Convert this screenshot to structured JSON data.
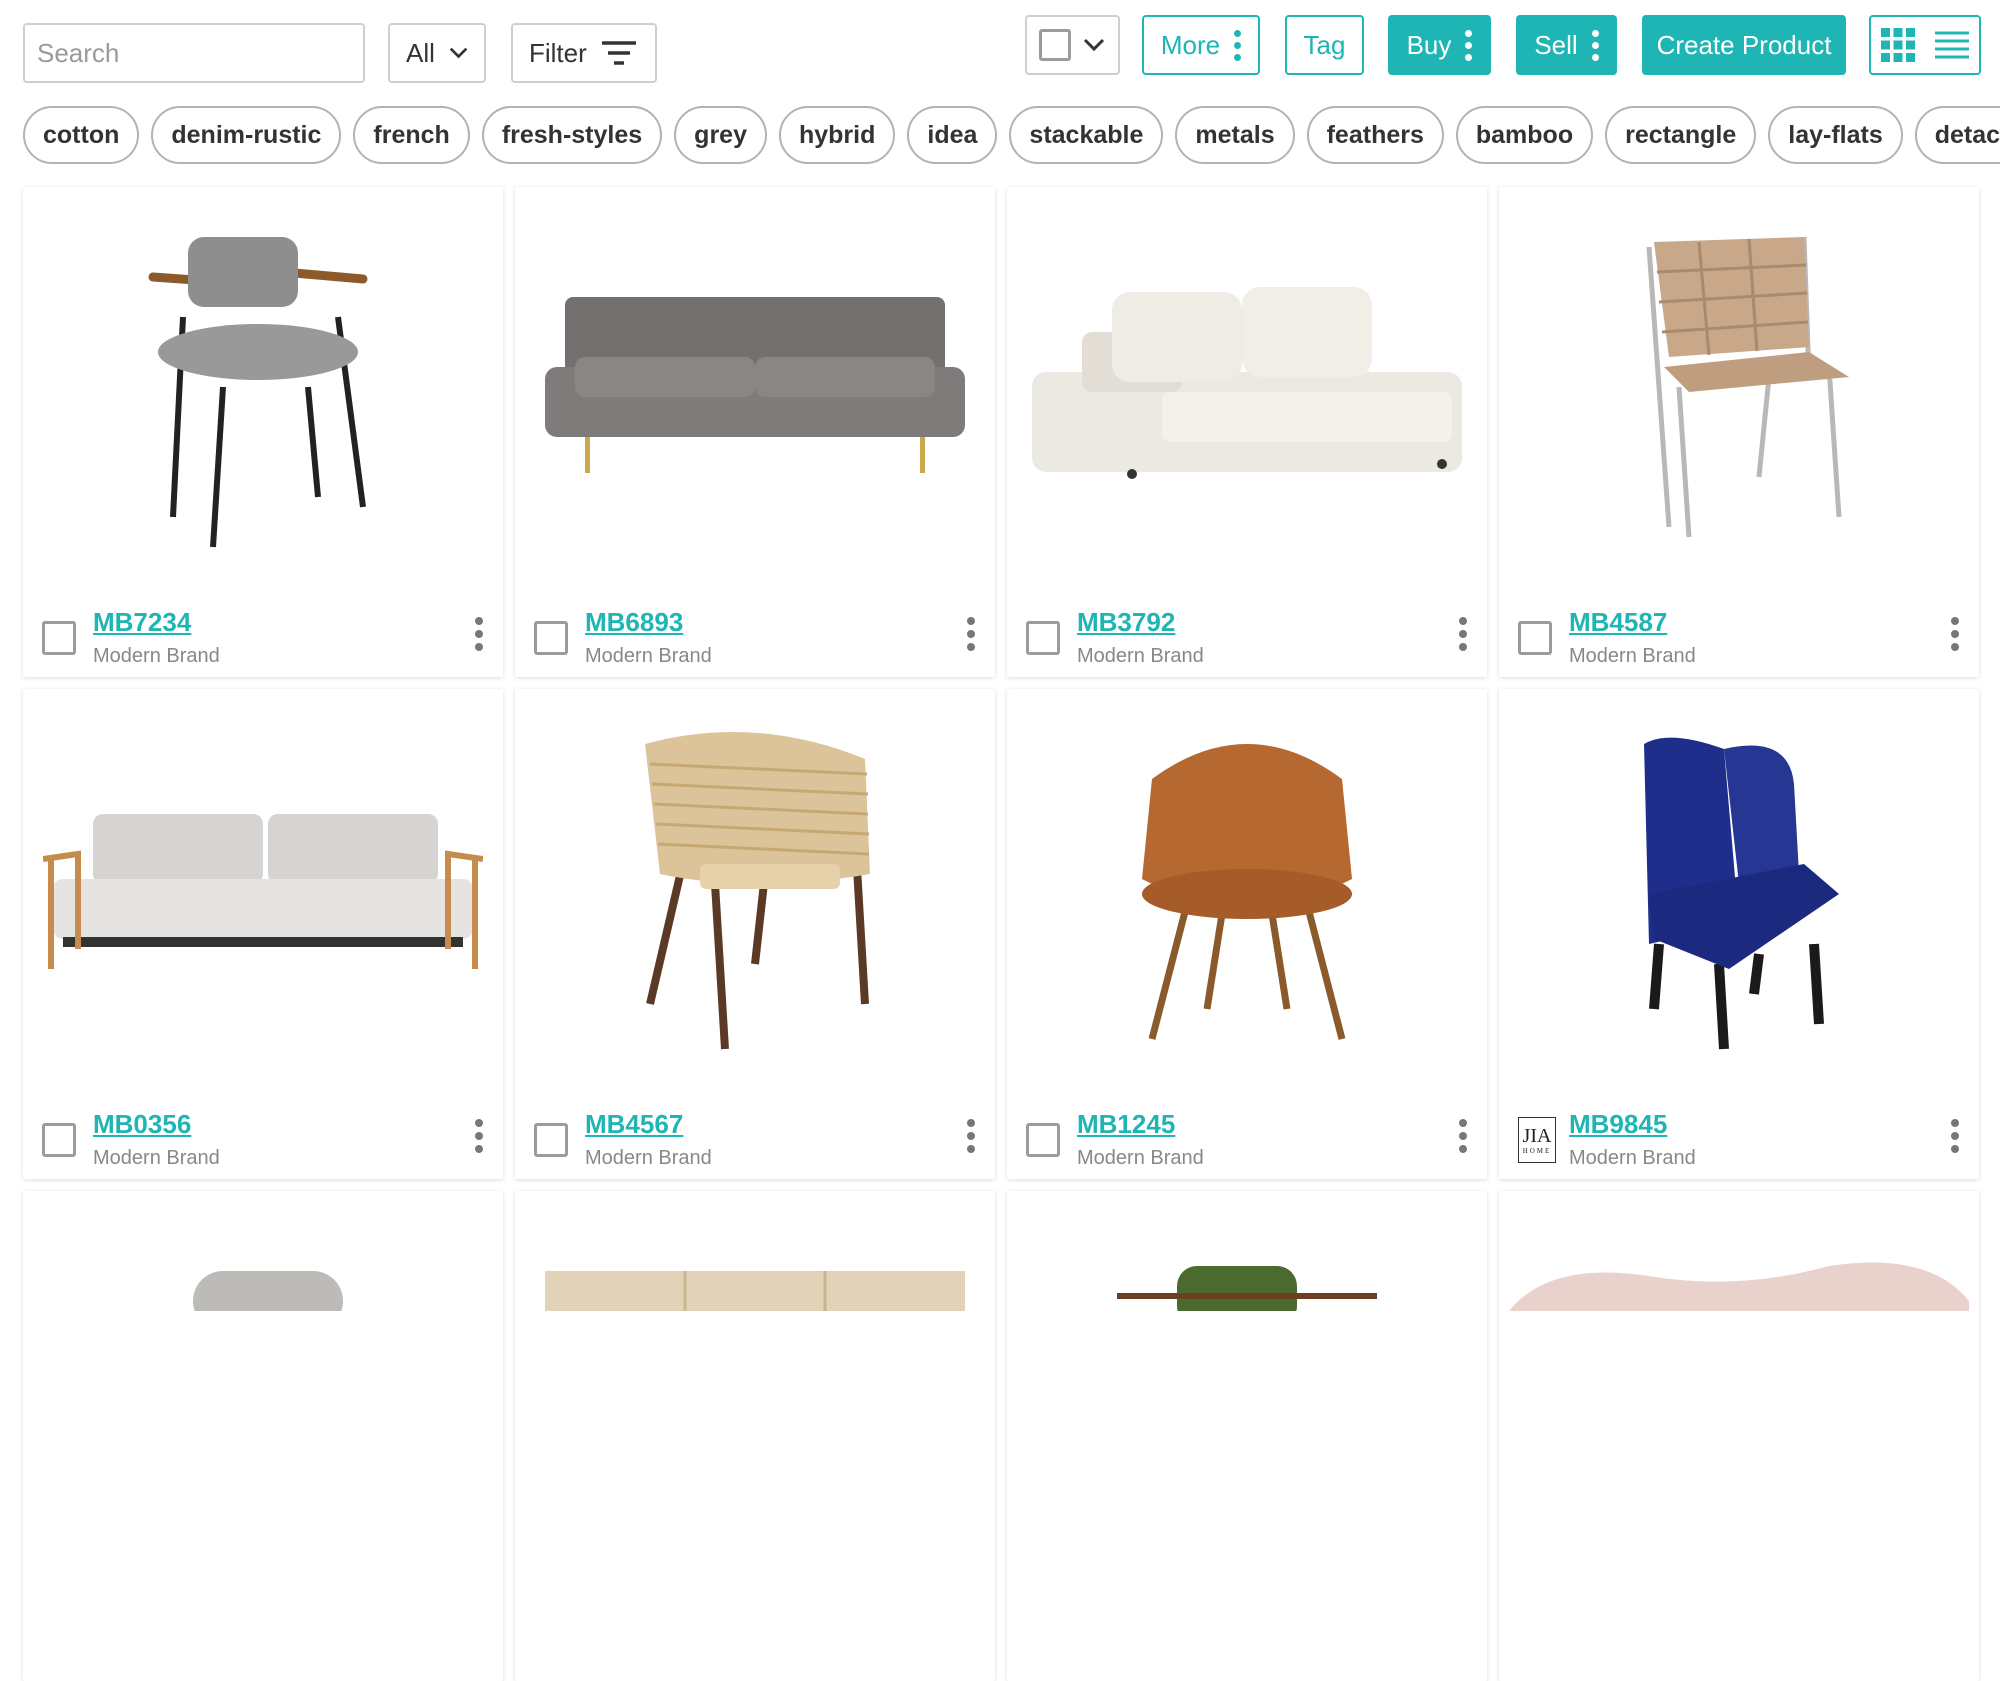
{
  "search": {
    "placeholder": "Search"
  },
  "toolbar": {
    "scope_label": "All",
    "filter_label": "Filter",
    "more_label": "More",
    "tag_label": "Tag",
    "buy_label": "Buy",
    "sell_label": "Sell",
    "create_label": "Create Product"
  },
  "colors": {
    "accent": "#1fb5b5"
  },
  "tags": [
    "cotton",
    "denim-rustic",
    "french",
    "fresh-styles",
    "grey",
    "hybrid",
    "idea",
    "stackable",
    "metals",
    "feathers",
    "bamboo",
    "rectangle",
    "lay-flats",
    "detached"
  ],
  "products": [
    {
      "code": "MB7234",
      "brand": "Modern Brand",
      "kind": "grey armchair"
    },
    {
      "code": "MB6893",
      "brand": "Modern Brand",
      "kind": "grey sofa"
    },
    {
      "code": "MB3792",
      "brand": "Modern Brand",
      "kind": "white sectional sofa"
    },
    {
      "code": "MB4587",
      "brand": "Modern Brand",
      "kind": "woven leather chair"
    },
    {
      "code": "MB0356",
      "brand": "Modern Brand",
      "kind": "light grey sofa"
    },
    {
      "code": "MB4567",
      "brand": "Modern Brand",
      "kind": "rattan armchair"
    },
    {
      "code": "MB1245",
      "brand": "Modern Brand",
      "kind": "leather shell chair"
    },
    {
      "code": "MB9845",
      "brand": "Modern Brand",
      "kind": "navy velvet wingback chair",
      "logo": "JIA",
      "logo_sub": "HOME"
    }
  ]
}
